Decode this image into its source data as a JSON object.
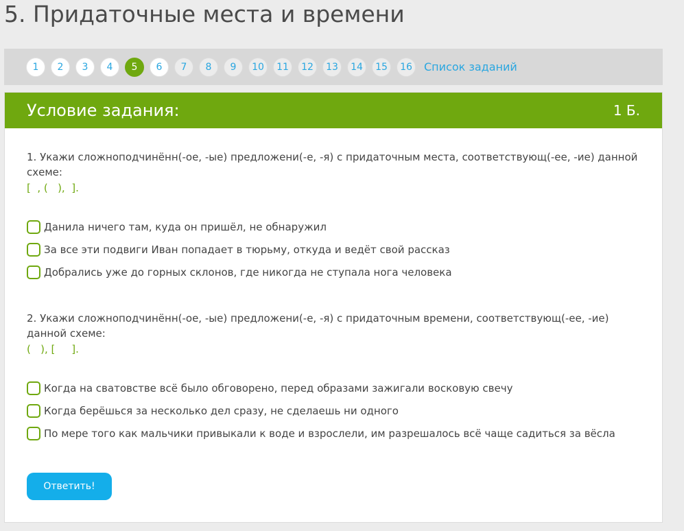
{
  "page": {
    "title": "5. Придаточные места и времени"
  },
  "nav": {
    "items": [
      "1",
      "2",
      "3",
      "4",
      "5",
      "6",
      "7",
      "8",
      "9",
      "10",
      "11",
      "12",
      "13",
      "14",
      "15",
      "16"
    ],
    "active": "5",
    "list_link": "Список заданий"
  },
  "card": {
    "title": "Условие задания:",
    "points": "1 Б."
  },
  "questions": [
    {
      "text": "1. Укажи сложноподчинённ(-ое, -ые) предложени(-е, -я) с придаточным места, соответствующ(-ее, -ие) данной схеме:",
      "scheme": "[  , (   ),  ].",
      "options": [
        "Данила ничего там, куда он пришёл, не обнаружил",
        "За все эти подвиги Иван попадает в тюрьму, откуда и ведёт свой рассказ",
        "Добрались уже до горных склонов, где никогда не ступала нога человека"
      ]
    },
    {
      "text": "2. Укажи сложноподчинённ(-ое, -ые) предложени(-е, -я) с придаточным времени, соответствующ(-ее, -ие) данной схеме:",
      "scheme": "(   ), [     ].",
      "options": [
        "Когда на сватовстве всё было обговорено, перед образами зажигали восковую свечу",
        "Когда берёшься за несколько дел сразу, не сделаешь ни одного",
        "По мере того как мальчики привыкали к воде и взрослели, им разрешалось всё чаще садиться за вёсла"
      ]
    }
  ],
  "submit_label": "Ответить!"
}
